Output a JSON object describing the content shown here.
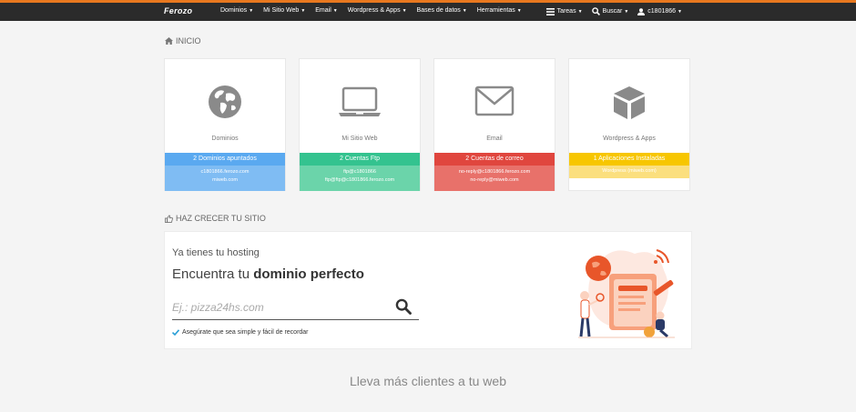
{
  "navbar": {
    "brand": "Ferozo",
    "menu": [
      {
        "label": "Dominios"
      },
      {
        "label": "Mi Sitio Web"
      },
      {
        "label": "Email"
      },
      {
        "label": "Wordpress & Apps"
      },
      {
        "label": "Bases de datos"
      },
      {
        "label": "Herramientas"
      }
    ],
    "tareas": "Tareas",
    "buscar": "Buscar",
    "user": "c1801866"
  },
  "inicio": {
    "title": "INICIO"
  },
  "cards": [
    {
      "label": "Dominios",
      "band_title": "2 Dominios apuntados",
      "lines": [
        "c1801866.ferozo.com",
        "miweb.com"
      ],
      "color1": "#5aa9f0",
      "color2": "#7fbcf3",
      "icon": "globe-icon"
    },
    {
      "label": "Mi Sitio Web",
      "band_title": "2 Cuentas Ftp",
      "lines": [
        "ftp@c1801866",
        "ftp@ftp@c1801866.ferozo.com"
      ],
      "color1": "#34c38f",
      "color2": "#6bd4aa",
      "icon": "laptop-icon"
    },
    {
      "label": "Email",
      "band_title": "2 Cuentas de correo",
      "lines": [
        "no-reply@c1801866.ferozo.com",
        "no-reply@miweb.com"
      ],
      "color1": "#e0463e",
      "color2": "#e8716a",
      "icon": "envelope-icon"
    },
    {
      "label": "Wordpress & Apps",
      "band_title": "1 Aplicaciones Instaladas",
      "lines": [
        "Wordpress (miweb.com)"
      ],
      "color1": "#f7c600",
      "color2": "#fbdf7e",
      "icon": "cube-icon"
    }
  ],
  "grow": {
    "title": "HAZ CRECER TU SITIO"
  },
  "promo": {
    "line1": "Ya tienes tu hosting",
    "line2_prefix": "Encuentra tu ",
    "line2_bold": "dominio perfecto",
    "placeholder": "Ej.: pizza24hs.com",
    "tip": "Asegúrate que sea simple y fácil de recordar"
  },
  "footer": {
    "text": "Lleva más clientes a tu web"
  }
}
